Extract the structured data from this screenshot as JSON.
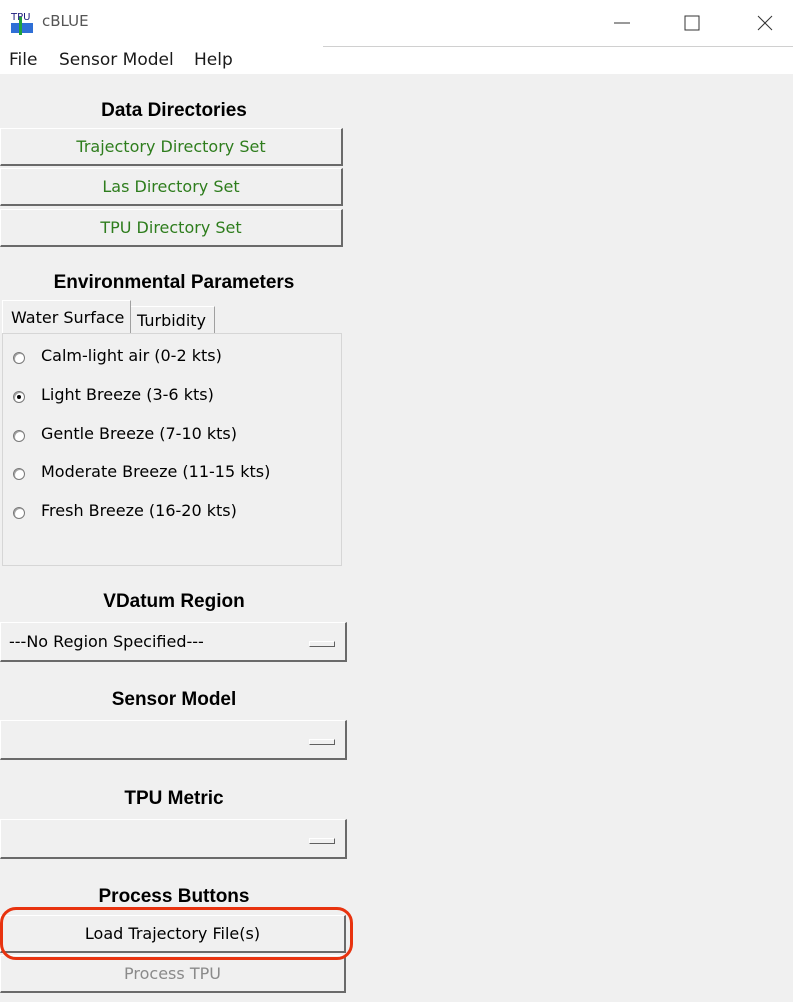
{
  "window": {
    "title": "cBLUE",
    "icon_text": "TPU",
    "icon_name": "tpu-app-icon",
    "controls": [
      "minimize-icon",
      "maximize-icon",
      "close-icon"
    ]
  },
  "menu": {
    "items": [
      "File",
      "Sensor Model",
      "Help"
    ]
  },
  "data_directories": {
    "title": "Data Directories",
    "buttons": [
      "Trajectory Directory Set",
      "Las Directory Set",
      "TPU Directory Set"
    ],
    "button_text_color": "#2e7d1d"
  },
  "environmental": {
    "title": "Environmental Parameters",
    "tabs": [
      "Water Surface",
      "Turbidity"
    ],
    "active_tab": "Water Surface",
    "options": [
      "Calm-light air (0-2 kts)",
      "Light Breeze (3-6 kts)",
      "Gentle Breeze (7-10 kts)",
      "Moderate Breeze (11-15 kts)",
      "Fresh Breeze (16-20 kts)"
    ],
    "selected_index": 1
  },
  "vdatum": {
    "title": "VDatum Region",
    "value": "---No Region Specified---"
  },
  "sensor_model": {
    "title": "Sensor Model",
    "value": ""
  },
  "tpu_metric": {
    "title": "TPU Metric",
    "value": ""
  },
  "process": {
    "title": "Process Buttons",
    "load_label": "Load Trajectory File(s)",
    "process_label": "Process TPU",
    "process_disabled_color": "#8a8a8a",
    "highlight_color": "#e8330f"
  }
}
